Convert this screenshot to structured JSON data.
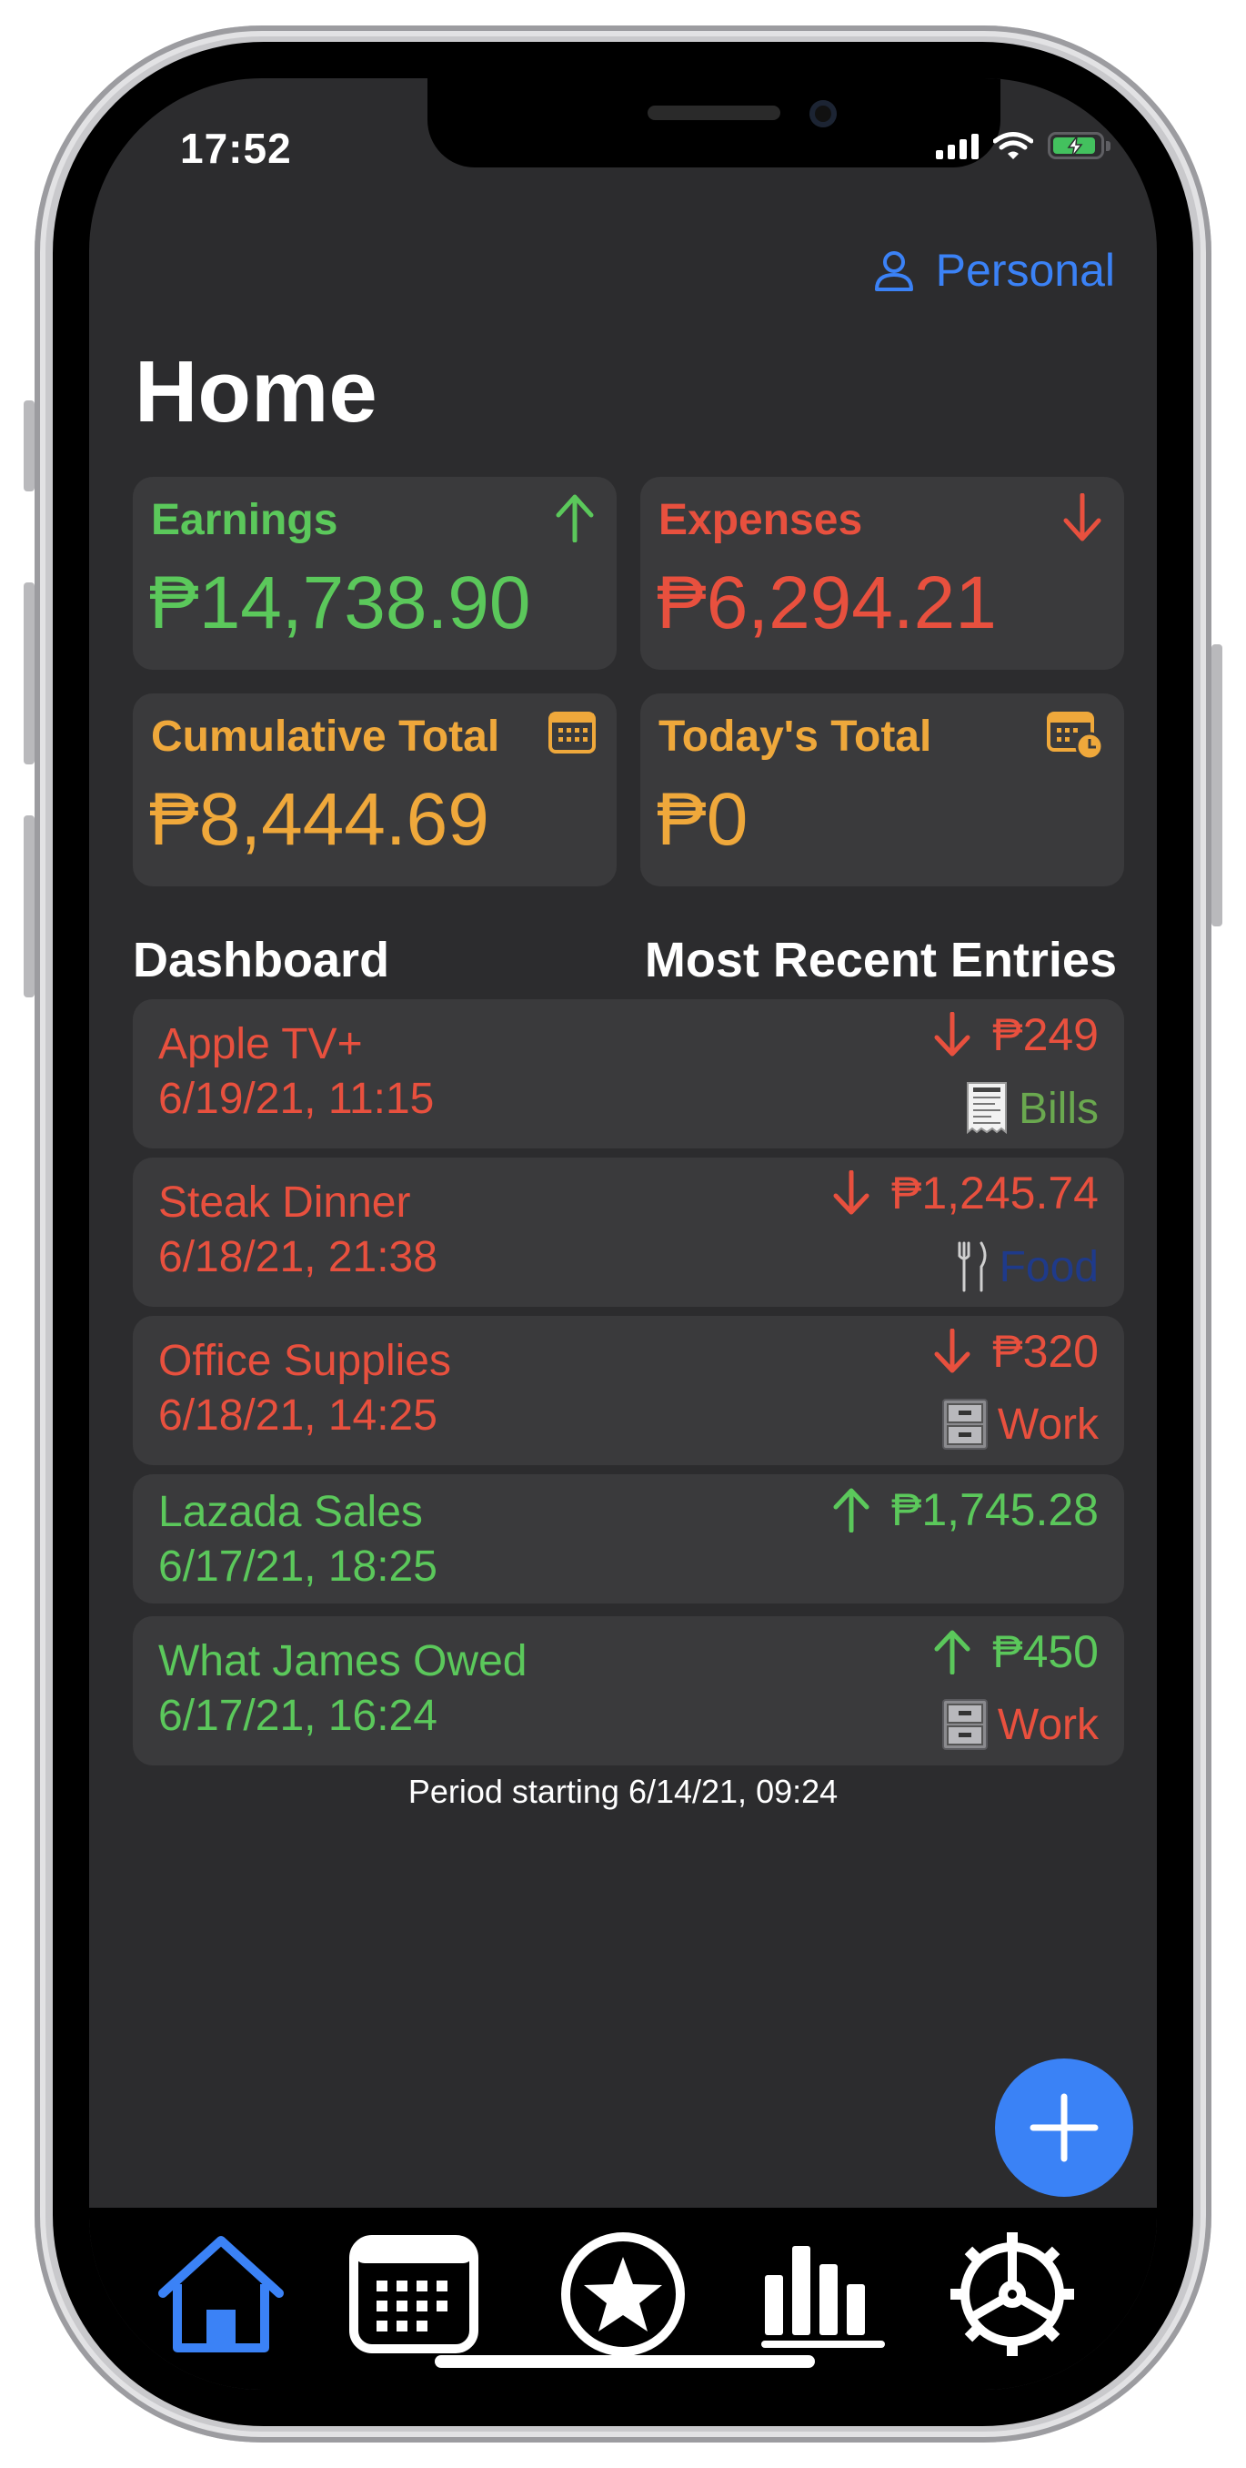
{
  "status_bar": {
    "time": "17:52"
  },
  "header": {
    "profile_label": "Personal",
    "title": "Home"
  },
  "summary_cards": {
    "earnings": {
      "title": "Earnings",
      "value": "₱14,738.90",
      "color": "#5bc85b"
    },
    "expenses": {
      "title": "Expenses",
      "value": "₱6,294.21",
      "color": "#e8503e"
    },
    "cumulative": {
      "title": "Cumulative Total",
      "value": "₱8,444.69",
      "color": "#efa83b"
    },
    "today": {
      "title": "Today's Total",
      "value": "₱0",
      "color": "#efa83b"
    }
  },
  "dashboard": {
    "left_label": "Dashboard",
    "right_label": "Most Recent Entries",
    "entries": [
      {
        "name": "Apple TV+",
        "date": "6/19/21, 11:15",
        "amount": "₱249",
        "direction": "down",
        "category": "Bills",
        "category_icon": "receipt-icon",
        "category_color": "#6aa84f"
      },
      {
        "name": "Steak Dinner",
        "date": "6/18/21, 21:38",
        "amount": "₱1,245.74",
        "direction": "down",
        "category": "Food",
        "category_icon": "fork-knife-icon",
        "category_color": "#1f3a8a"
      },
      {
        "name": "Office Supplies",
        "date": "6/18/21, 14:25",
        "amount": "₱320",
        "direction": "down",
        "category": "Work",
        "category_icon": "file-cabinet-icon",
        "category_color": "#e8503e"
      },
      {
        "name": "Lazada Sales",
        "date": "6/17/21, 18:25",
        "amount": "₱1,745.28",
        "direction": "up",
        "category": "",
        "category_icon": "",
        "category_color": ""
      },
      {
        "name": "What James Owed",
        "date": "6/17/21, 16:24",
        "amount": "₱450",
        "direction": "up",
        "category": "Work",
        "category_icon": "file-cabinet-icon",
        "category_color": "#e8503e"
      }
    ]
  },
  "period_text": "Period starting 6/14/21, 09:24",
  "tab_bar": {
    "tabs": [
      "home-icon",
      "calendar-icon",
      "star-icon",
      "bar-chart-icon",
      "settings-gear-icon"
    ],
    "active": "home-icon",
    "active_color": "#3b82f6"
  }
}
